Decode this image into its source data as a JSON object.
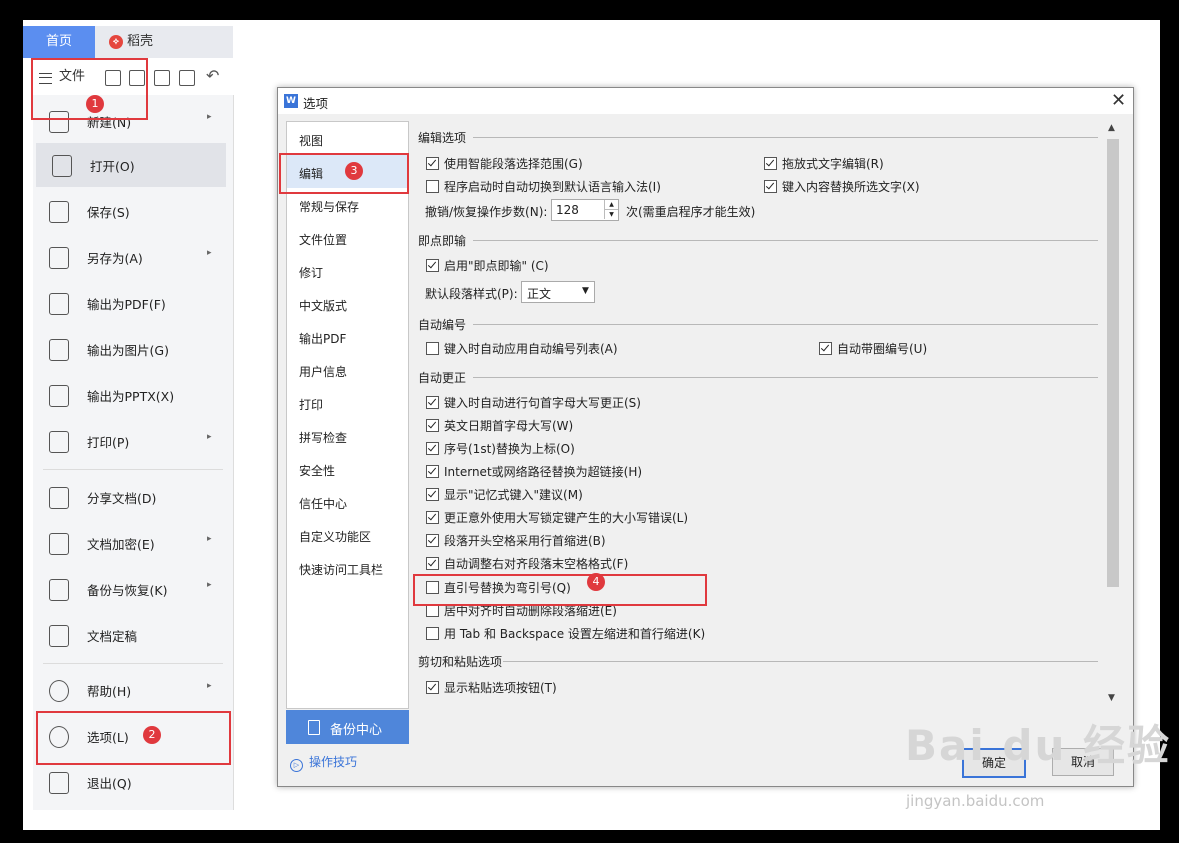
{
  "tabs": {
    "home": "首页",
    "daoke": "稻壳"
  },
  "toolbar": {
    "file_label": "文件"
  },
  "file_menu": {
    "items": [
      {
        "label": "新建(N)",
        "has_arrow": true
      },
      {
        "label": "打开(O)",
        "has_arrow": false
      },
      {
        "label": "保存(S)",
        "has_arrow": false
      },
      {
        "label": "另存为(A)",
        "has_arrow": true
      },
      {
        "label": "输出为PDF(F)",
        "has_arrow": false
      },
      {
        "label": "输出为图片(G)",
        "has_arrow": false
      },
      {
        "label": "输出为PPTX(X)",
        "has_arrow": false
      },
      {
        "label": "打印(P)",
        "has_arrow": true
      },
      {
        "label": "分享文档(D)",
        "has_arrow": false
      },
      {
        "label": "文档加密(E)",
        "has_arrow": true
      },
      {
        "label": "备份与恢复(K)",
        "has_arrow": true
      },
      {
        "label": "文档定稿",
        "has_arrow": false
      },
      {
        "label": "帮助(H)",
        "has_arrow": true
      },
      {
        "label": "选项(L)",
        "has_arrow": false
      },
      {
        "label": "退出(Q)",
        "has_arrow": false
      }
    ],
    "arrow": "▸"
  },
  "annotations": {
    "b1": "1",
    "b2": "2",
    "b3": "3",
    "b4": "4"
  },
  "dialog": {
    "title": "选项",
    "logo": "W",
    "close": "✕",
    "nav": [
      "视图",
      "编辑",
      "常规与保存",
      "文件位置",
      "修订",
      "中文版式",
      "输出PDF",
      "用户信息",
      "打印",
      "拼写检查",
      "安全性",
      "信任中心",
      "自定义功能区",
      "快速访问工具栏"
    ],
    "backup_center": "备份中心",
    "tips": "操作技巧",
    "tips_icon": "▷",
    "sections": {
      "edit_options": "编辑选项",
      "click_type": "即点即输",
      "auto_number": "自动编号",
      "auto_correct": "自动更正",
      "cut_paste": "剪切和粘贴选项"
    },
    "edit": {
      "smart_para": "使用智能段落选择范围(G)",
      "drag_drop": "拖放式文字编辑(R)",
      "auto_ime": "程序启动时自动切换到默认语言输入法(I)",
      "replace_sel": "键入内容替换所选文字(X)",
      "undo_label": "撤销/恢复操作步数(N):",
      "undo_value": "128",
      "undo_note": "次(需重启程序才能生效)"
    },
    "click": {
      "enable": "启用\"即点即输\" (C)",
      "default_style_label": "默认段落样式(P):",
      "default_style_value": "正文"
    },
    "number": {
      "auto_list": "键入时自动应用自动编号列表(A)",
      "circled": "自动带圈编号(U)"
    },
    "correct": [
      {
        "label": "键入时自动进行句首字母大写更正(S)",
        "checked": true
      },
      {
        "label": "英文日期首字母大写(W)",
        "checked": true
      },
      {
        "label": "序号(1st)替换为上标(O)",
        "checked": true
      },
      {
        "label": "Internet或网络路径替换为超链接(H)",
        "checked": true
      },
      {
        "label": "显示\"记忆式键入\"建议(M)",
        "checked": true
      },
      {
        "label": "更正意外使用大写锁定键产生的大小写错误(L)",
        "checked": true
      },
      {
        "label": "段落开头空格采用行首缩进(B)",
        "checked": true
      },
      {
        "label": "自动调整右对齐段落末空格格式(F)",
        "checked": true
      },
      {
        "label": "直引号替换为弯引号(Q)",
        "checked": false
      },
      {
        "label": "居中对齐时自动删除段落缩进(E)",
        "checked": false
      },
      {
        "label": "用 Tab 和 Backspace 设置左缩进和首行缩进(K)",
        "checked": false
      }
    ],
    "paste": {
      "show_btn": "显示粘贴选项按钮(T)"
    },
    "ok": "确定",
    "cancel": "取消"
  },
  "watermark": {
    "main": "Bai du 经验",
    "sub": "jingyan.baidu.com"
  }
}
